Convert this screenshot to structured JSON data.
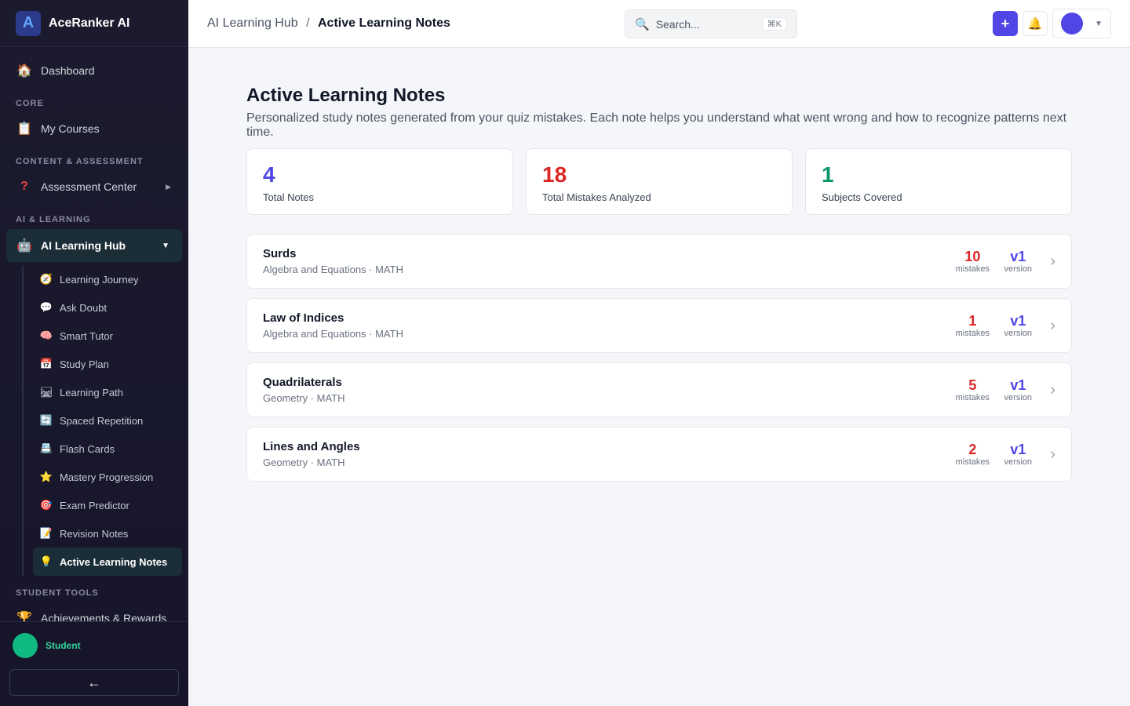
{
  "app": {
    "name": "AceRanker AI",
    "logo_letter": "A"
  },
  "sidebar": {
    "dashboard": "Dashboard",
    "sections": {
      "core": "CORE",
      "content": "CONTENT & ASSESSMENT",
      "ai": "AI & LEARNING",
      "tools": "STUDENT TOOLS"
    },
    "my_courses": "My Courses",
    "assessment_center": "Assessment Center",
    "ai_learning_hub": "AI Learning Hub",
    "sub_items": [
      {
        "label": "Learning Journey",
        "icon": "🧭"
      },
      {
        "label": "Ask Doubt",
        "icon": "💬"
      },
      {
        "label": "Smart Tutor",
        "icon": "🧠"
      },
      {
        "label": "Study Plan",
        "icon": "📅"
      },
      {
        "label": "Learning Path",
        "icon": "🛤"
      },
      {
        "label": "Spaced Repetition",
        "icon": "🔄"
      },
      {
        "label": "Flash Cards",
        "icon": "📇"
      },
      {
        "label": "Mastery Progression",
        "icon": "⭐"
      },
      {
        "label": "Exam Predictor",
        "icon": "🎯"
      },
      {
        "label": "Revision Notes",
        "icon": "📝"
      },
      {
        "label": "Active Learning Notes",
        "icon": "💡"
      }
    ],
    "achievements": "Achievements & Rewards",
    "user_role": "Student",
    "collapse_glyph": "←"
  },
  "topbar": {
    "breadcrumb_parent": "AI Learning Hub",
    "breadcrumb_sep": "/",
    "breadcrumb_current": "Active Learning Notes",
    "search_placeholder": "Search...",
    "search_shortcut": "⌘K",
    "plus_glyph": "+"
  },
  "page": {
    "title": "Active Learning Notes",
    "description": "Personalized study notes generated from your quiz mistakes. Each note helps you understand what went wrong and how to recognize patterns next time."
  },
  "stats": [
    {
      "value": "4",
      "label": "Total Notes",
      "color": "#4f46e5"
    },
    {
      "value": "18",
      "label": "Total Mistakes Analyzed",
      "color": "#dc2626"
    },
    {
      "value": "1",
      "label": "Subjects Covered",
      "color": "#059669"
    }
  ],
  "notes": [
    {
      "title": "Surds",
      "meta": "Algebra and Equations · MATH",
      "mistakes": "10",
      "version": "v1"
    },
    {
      "title": "Law of Indices",
      "meta": "Algebra and Equations · MATH",
      "mistakes": "1",
      "version": "v1"
    },
    {
      "title": "Quadrilaterals",
      "meta": "Geometry · MATH",
      "mistakes": "5",
      "version": "v1"
    },
    {
      "title": "Lines and Angles",
      "meta": "Geometry · MATH",
      "mistakes": "2",
      "version": "v1"
    }
  ],
  "labels": {
    "mistakes": "mistakes",
    "version": "version"
  },
  "colors": {
    "mistakes": "#dc2626",
    "version": "#4f46e5"
  }
}
